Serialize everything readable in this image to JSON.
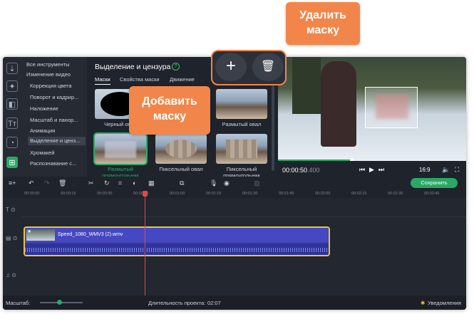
{
  "sidebar_menu": {
    "items": [
      "Все инструменты",
      "Изменение видео",
      "Коррекция цвета",
      "Поворот и кадрир...",
      "Наложение",
      "Масштаб и панор...",
      "Анимация",
      "Выделение и ценз...",
      "Хромакей",
      "Распознавание с..."
    ]
  },
  "left_icons": [
    "import-icon",
    "magic-icon",
    "transitions-icon",
    "titles-icon",
    "clock-icon",
    "tools-icon"
  ],
  "panel": {
    "title": "Выделение и цензура",
    "tabs": [
      "Маски",
      "Свойства маски",
      "Движение"
    ],
    "masks": [
      {
        "label": "Черный овал"
      },
      {
        "label": ""
      },
      {
        "label": "Размытый овал"
      },
      {
        "label": "Размытый прямоугольник"
      },
      {
        "label": "Пиксельный овал"
      },
      {
        "label": "Пиксельный прямоугольник"
      }
    ]
  },
  "callouts": {
    "delete_mask": "Удалить маску",
    "add_mask": "Добавить маску"
  },
  "player": {
    "time_main": "00:00:50",
    "time_ms": ".400",
    "aspect": "16:9"
  },
  "toolbar": {
    "save_label": "Сохранить"
  },
  "ruler": {
    "ticks": [
      "00:00:00",
      "00:00:15",
      "00:00:30",
      "00:00:45",
      "00:01:00",
      "00:01:15",
      "00:01:30",
      "00:01:45",
      "00:02:00",
      "00:02:15",
      "00:02:30",
      "00:02:45"
    ]
  },
  "clip": {
    "name": "Speed_1080_WMV3 (2).wmv"
  },
  "statusbar": {
    "scale_label": "Масштаб:",
    "duration_label": "Длительность проекта:",
    "duration_value": "02:07",
    "notifications_label": "Уведомления"
  },
  "colors": {
    "accent": "#2aa866",
    "callout": "#f2864a",
    "clip_border": "#e8c547",
    "playhead": "#e34848"
  }
}
